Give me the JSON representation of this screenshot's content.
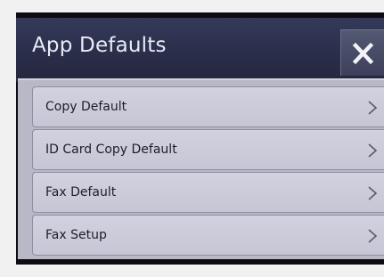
{
  "header": {
    "title": "App Defaults",
    "close_icon": "close-icon"
  },
  "menu": {
    "items": [
      {
        "label": "Copy Default",
        "icon": "chevron-right-icon"
      },
      {
        "label": "ID Card Copy Default",
        "icon": "chevron-right-icon"
      },
      {
        "label": "Fax Default",
        "icon": "chevron-right-icon"
      },
      {
        "label": "Fax Setup",
        "icon": "chevron-right-icon"
      }
    ]
  },
  "colors": {
    "titlebar": "#2a2e4a",
    "title_text": "#e9ecf6",
    "list_background": "#b9b8c7",
    "item_text": "#1d1d2b"
  }
}
